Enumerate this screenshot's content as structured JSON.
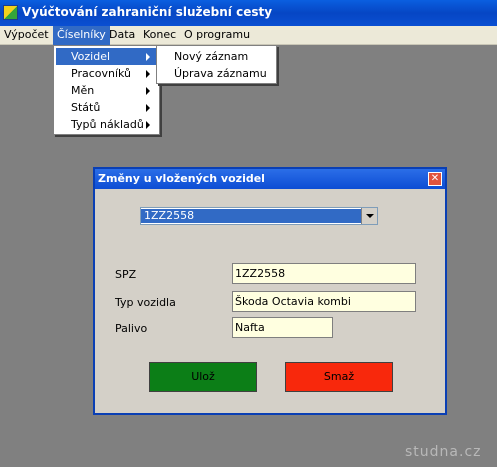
{
  "window": {
    "title": "Vyúčtování zahraniční služební cesty"
  },
  "menubar": {
    "items": [
      {
        "label": "Výpočet"
      },
      {
        "label": "Číselníky"
      },
      {
        "label": "Data"
      },
      {
        "label": "Konec"
      },
      {
        "label": "O programu"
      }
    ],
    "active": "Číselníky"
  },
  "ciselniky_menu": {
    "items": [
      {
        "label": "Vozidel"
      },
      {
        "label": "Pracovníků"
      },
      {
        "label": "Měn"
      },
      {
        "label": "Států"
      },
      {
        "label": "Typů nákladů"
      }
    ],
    "highlighted": "Vozidel"
  },
  "vozidel_submenu": {
    "items": [
      {
        "label": "Nový záznam"
      },
      {
        "label": "Úprava záznamu"
      }
    ]
  },
  "dialog": {
    "title": "Změny u vložených vozidel",
    "select": {
      "value": "1ZZ2558"
    },
    "fields": {
      "spz": {
        "label": "SPZ",
        "value": "1ZZ2558"
      },
      "typ_vozidla": {
        "label": "Typ vozidla",
        "value": "Škoda Octavia kombi"
      },
      "palivo": {
        "label": "Palivo",
        "value": "Nafta"
      }
    },
    "buttons": {
      "save_label": "Ulož",
      "delete_label": "Smaž"
    }
  },
  "watermark": "studna.cz",
  "colors": {
    "title_bar": "#0a4fd2",
    "workspace": "#808080",
    "menu_highlight": "#316ac5",
    "dialog_bg": "#d4d0c8",
    "input_bg": "#ffffe0",
    "save_button": "#0c7e17",
    "delete_button": "#f8280c"
  }
}
